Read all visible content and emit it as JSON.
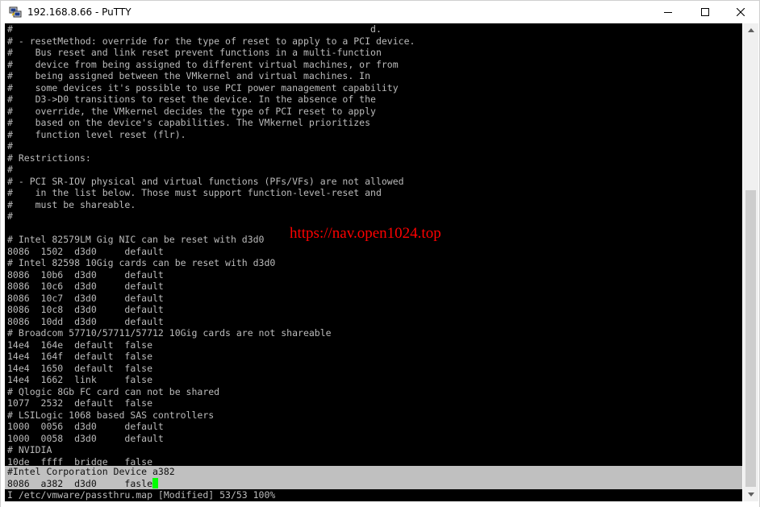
{
  "window": {
    "title": "192.168.8.66 - PuTTY",
    "minimize_symbol": "—",
    "maximize_symbol": "☐",
    "close_symbol": "✕",
    "app_icon": "putty-icon"
  },
  "terminal": {
    "lines": [
      "#                                                                d.",
      "# - resetMethod: override for the type of reset to apply to a PCI device.",
      "#    Bus reset and link reset prevent functions in a multi-function",
      "#    device from being assigned to different virtual machines, or from",
      "#    being assigned between the VMkernel and virtual machines. In",
      "#    some devices it's possible to use PCI power management capability",
      "#    D3->D0 transitions to reset the device. In the absence of the",
      "#    override, the VMkernel decides the type of PCI reset to apply",
      "#    based on the device's capabilities. The VMkernel prioritizes",
      "#    function level reset (flr).",
      "#",
      "# Restrictions:",
      "#",
      "# - PCI SR-IOV physical and virtual functions (PFs/VFs) are not allowed",
      "#    in the list below. Those must support function-level-reset and",
      "#    must be shareable.",
      "#",
      "",
      "# Intel 82579LM Gig NIC can be reset with d3d0",
      "8086  1502  d3d0     default",
      "# Intel 82598 10Gig cards can be reset with d3d0",
      "8086  10b6  d3d0     default",
      "8086  10c6  d3d0     default",
      "8086  10c7  d3d0     default",
      "8086  10c8  d3d0     default",
      "8086  10dd  d3d0     default",
      "# Broadcom 57710/57711/57712 10Gig cards are not shareable",
      "14e4  164e  default  false",
      "14e4  164f  default  false",
      "14e4  1650  default  false",
      "14e4  1662  link     false",
      "# Qlogic 8Gb FC card can not be shared",
      "1077  2532  default  false",
      "# LSILogic 1068 based SAS controllers",
      "1000  0056  d3d0     default",
      "1000  0058  d3d0     default",
      "# NVIDIA",
      "10de  ffff  bridge   false"
    ],
    "highlight_lines": [
      "#Intel Corporation Device a382",
      "8086  a382  d3d0     fasle"
    ],
    "status_line": "I /etc/vmware/passthru.map [Modified] 53/53 100%",
    "fg_color": "#bbbbbb",
    "bg_color": "#000000",
    "cursor_color": "#00ff00",
    "highlight_color": "#c0c0c0"
  },
  "watermark": {
    "text": "https://nav.open1024.top",
    "color": "#ff0000"
  },
  "scrollbar": {
    "up_arrow": "▲",
    "down_arrow": "▼"
  }
}
